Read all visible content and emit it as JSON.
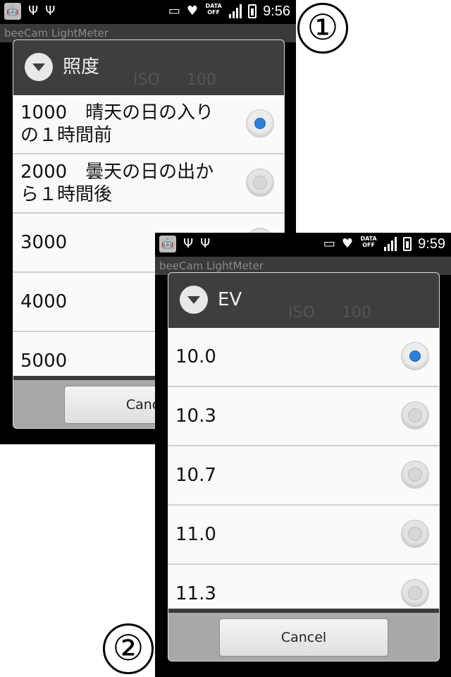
{
  "screen1": {
    "status_time": "9:56",
    "data_off": [
      "DATA",
      "OFF"
    ],
    "app_title": "beeCam LightMeter",
    "dialog_title": "照度",
    "header_faint": [
      "ISO",
      "100"
    ],
    "options": [
      {
        "label": "1000　晴天の日の入り\nの１時間前",
        "selected": true
      },
      {
        "label": "2000　曇天の日の出か\nら１時間後",
        "selected": false
      },
      {
        "label": "3000",
        "selected": false
      },
      {
        "label": "4000",
        "selected": false
      },
      {
        "label": "5000",
        "selected": false
      }
    ],
    "cancel_label": "Cancel",
    "badge": "①"
  },
  "screen2": {
    "status_time": "9:59",
    "data_off": [
      "DATA",
      "OFF"
    ],
    "app_title": "beeCam LightMeter",
    "dialog_title": "EV",
    "header_faint": [
      "ISO",
      "100"
    ],
    "options": [
      {
        "label": "10.0",
        "selected": true
      },
      {
        "label": "10.3",
        "selected": false
      },
      {
        "label": "10.7",
        "selected": false
      },
      {
        "label": "11.0",
        "selected": false
      },
      {
        "label": "11.3",
        "selected": false
      }
    ],
    "cancel_label": "Cancel",
    "badge": "②"
  },
  "icons": [
    "android-icon",
    "usb-icon",
    "voicemail-icon",
    "phone-heart-icon",
    "signal-icon",
    "battery-icon"
  ]
}
